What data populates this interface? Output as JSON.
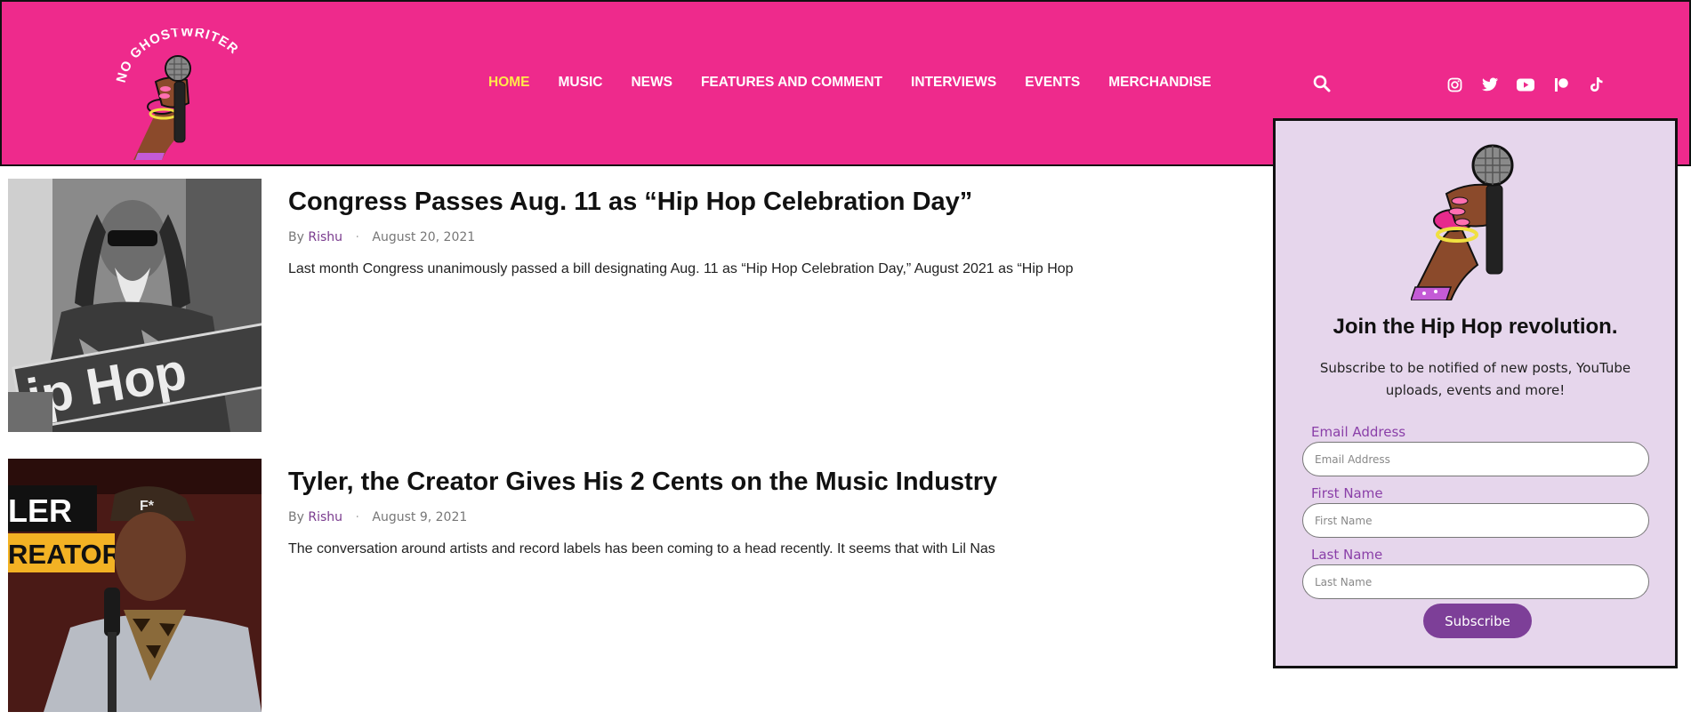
{
  "logo": {
    "alt": "NO GHOSTWRITER",
    "text": "NO GHOSTWRITER"
  },
  "nav": {
    "items": [
      {
        "label": "HOME",
        "active": true
      },
      {
        "label": "MUSIC"
      },
      {
        "label": "NEWS"
      },
      {
        "label": "FEATURES AND COMMENT"
      },
      {
        "label": "INTERVIEWS"
      },
      {
        "label": "EVENTS"
      },
      {
        "label": "MERCHANDISE"
      }
    ]
  },
  "icons": {
    "search": "search-icon",
    "social": [
      "instagram-icon",
      "twitter-icon",
      "youtube-icon",
      "patreon-icon",
      "tiktok-icon"
    ]
  },
  "articles": [
    {
      "title": "Congress Passes Aug. 11 as “Hip Hop Celebration Day”",
      "by": "By",
      "author": "Rishu",
      "separator": "·",
      "date": "August 20, 2021",
      "excerpt": "Last month Congress unanimously passed a bill designating Aug. 11 as “Hip Hop Celebration Day,” August 2021 as “Hip Hop",
      "image_text": "ip Hop"
    },
    {
      "title": "Tyler, the Creator Gives His 2 Cents on the Music Industry",
      "by": "By",
      "author": "Rishu",
      "separator": "·",
      "date": "August 9, 2021",
      "excerpt": "The conversation around artists and record labels has been coming to a head recently. It seems that with Lil Nas",
      "image_text_1": "LER",
      "image_text_2": "REATOR"
    }
  ],
  "popup": {
    "title": "Join the Hip Hop revolution.",
    "subtitle": "Subscribe to be notified of new posts, YouTube uploads, events and more!",
    "email_label": "Email Address",
    "email_placeholder": "Email Address",
    "first_label": "First Name",
    "first_placeholder": "First Name",
    "last_label": "Last Name",
    "last_placeholder": "Last Name",
    "subscribe_label": "Subscribe"
  },
  "colors": {
    "header_bg": "#ee2a8c",
    "nav_active": "#ffe94a",
    "popup_bg": "#e6d6ec",
    "accent_purple": "#7d3f98",
    "author_color": "#7a3b8e"
  }
}
